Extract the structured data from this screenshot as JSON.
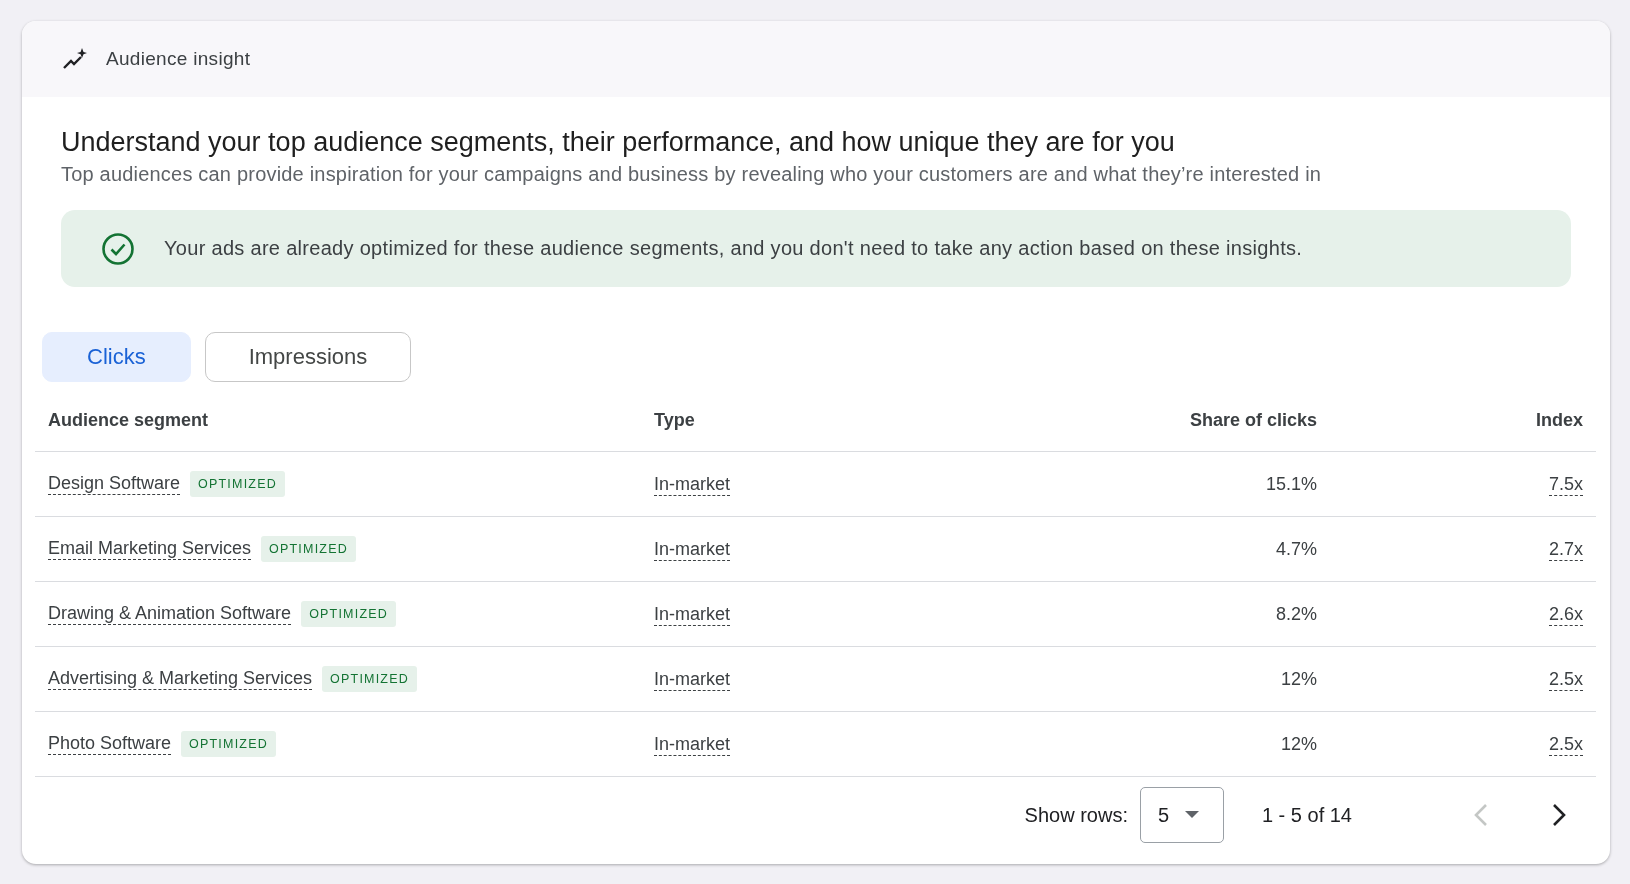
{
  "card": {
    "title": "Audience insight"
  },
  "headline": "Understand your top audience segments, their performance, and how unique they are for you",
  "subtitle": "Top audiences can provide inspiration for your campaigns and business by revealing who your customers are and what they’re interested in",
  "banner": {
    "text": "Your ads are already optimized for these audience segments, and you don't need to take any action based on these insights."
  },
  "tabs": [
    {
      "label": "Clicks",
      "selected": true
    },
    {
      "label": "Impressions",
      "selected": false
    }
  ],
  "table": {
    "columns": [
      "Audience segment",
      "Type",
      "Share of clicks",
      "Index"
    ],
    "rows": [
      {
        "segment": "Design Software",
        "badge": "OPTIMIZED",
        "type": "In-market",
        "share": "15.1%",
        "index": "7.5x"
      },
      {
        "segment": "Email Marketing Services",
        "badge": "OPTIMIZED",
        "type": "In-market",
        "share": "4.7%",
        "index": "2.7x"
      },
      {
        "segment": "Drawing & Animation Software",
        "badge": "OPTIMIZED",
        "type": "In-market",
        "share": "8.2%",
        "index": "2.6x"
      },
      {
        "segment": "Advertising & Marketing Services",
        "badge": "OPTIMIZED",
        "type": "In-market",
        "share": "12%",
        "index": "2.5x"
      },
      {
        "segment": "Photo Software",
        "badge": "OPTIMIZED",
        "type": "In-market",
        "share": "12%",
        "index": "2.5x"
      }
    ]
  },
  "pagination": {
    "rows_label": "Show rows:",
    "rows_value": "5",
    "range": "1 - 5 of 14",
    "prev_disabled": true,
    "next_disabled": false
  }
}
